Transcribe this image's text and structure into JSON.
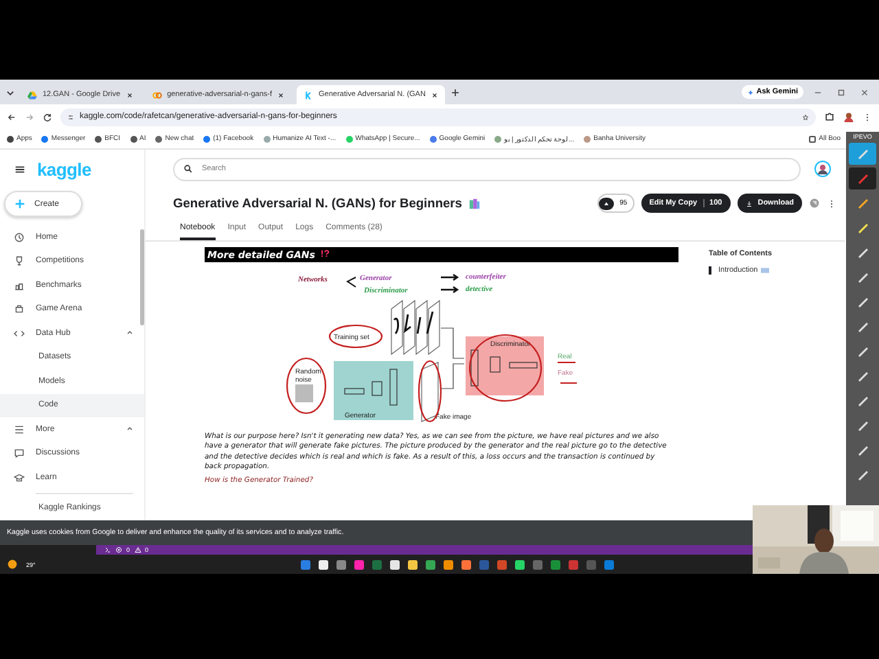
{
  "browser": {
    "tabs": [
      {
        "title": "12.GAN - Google Drive",
        "selected": false
      },
      {
        "title": "generative-adversarial-n-gans-f",
        "selected": false
      },
      {
        "title": "Generative Adversarial N. (GAN",
        "selected": true
      }
    ],
    "ask_gemini": "Ask Gemini",
    "url": "kaggle.com/code/rafetcan/generative-adversarial-n-gans-for-beginners",
    "bookmarks": [
      "Apps",
      "Messenger",
      "BFCI",
      "AI",
      "New chat",
      "(1) Facebook",
      "Humanize AI Text -...",
      "WhatsApp | Secure...",
      "Google Gemini",
      "لوحة تحكم الدكتور | بو...",
      "Banha University"
    ],
    "all_bookmarks": "All Boo"
  },
  "sidebar": {
    "logo": "kaggle",
    "create": "Create",
    "items": [
      {
        "label": "Home",
        "selected": false
      },
      {
        "label": "Competitions",
        "selected": false
      },
      {
        "label": "Benchmarks",
        "selected": false
      },
      {
        "label": "Game Arena",
        "selected": false
      },
      {
        "label": "Data Hub",
        "expanded": true,
        "selected": false,
        "children": [
          {
            "label": "Datasets",
            "selected": false
          },
          {
            "label": "Models",
            "selected": false
          },
          {
            "label": "Code",
            "selected": true
          }
        ]
      },
      {
        "label": "More",
        "expanded": true,
        "selected": false,
        "children": [
          {
            "label": "Discussions",
            "selected": false
          },
          {
            "label": "Learn",
            "selected": false
          }
        ]
      }
    ],
    "footer_link": "Kaggle Rankings"
  },
  "header": {
    "search": {
      "placeholder": "Search"
    }
  },
  "notebook": {
    "title": "Generative Adversarial N. (GANs) for Beginners",
    "votes": "95",
    "edit_button": "Edit My Copy",
    "edit_count": "100",
    "download_button": "Download",
    "tabs": [
      {
        "label": "Notebook",
        "selected": true
      },
      {
        "label": "Input",
        "selected": false
      },
      {
        "label": "Output",
        "selected": false
      },
      {
        "label": "Logs",
        "selected": false
      },
      {
        "label": "Comments (28)",
        "selected": false
      }
    ],
    "section_heading": "More detailed GANs",
    "section_mark": "!?",
    "diagram": {
      "networks": "Networks",
      "generator": "Generator",
      "discriminator": "Discriminator",
      "counterfeiter": "counterfeiter",
      "detective": "detective",
      "training_set": "Training set",
      "random_noise": [
        "Random",
        "noise"
      ],
      "generator_box": "Generator",
      "fake_image": "Fake image",
      "discriminator_box": "Discriminator",
      "real": "Real",
      "fake": "Fake"
    },
    "paragraph": "What is our purpose here? Isn't it generating new data? Yes, as we can see from the picture, we have real pictures and we also have a generator that will generate fake pictures. The picture produced by the generator and the real picture go to the detective and the detective decides which is real and which is fake. As a result of this, a loss occurs and the transaction is continued by back propagation.",
    "subheading": "How is the Generator Trained?"
  },
  "toc": {
    "title": "Table of Contents",
    "items": [
      {
        "label": "Introduction",
        "selected": true
      }
    ]
  },
  "cookie_banner": "Kaggle uses cookies from Google to deliver and enhance the quality of its services and to analyze traffic.",
  "status_bar": {
    "errors": "0",
    "warnings": "0"
  },
  "taskbar": {
    "temperature": "29°"
  },
  "annotation_toolbar": {
    "label": "IPEVO",
    "tools": [
      {
        "selected": false
      },
      {
        "selected": true
      },
      {
        "selected": false
      },
      {
        "selected": false
      },
      {
        "selected": false
      },
      {
        "selected": false
      },
      {
        "selected": false
      },
      {
        "selected": false
      },
      {
        "selected": false
      },
      {
        "selected": false
      },
      {
        "selected": false
      },
      {
        "selected": false
      },
      {
        "selected": false
      },
      {
        "selected": false
      }
    ]
  }
}
